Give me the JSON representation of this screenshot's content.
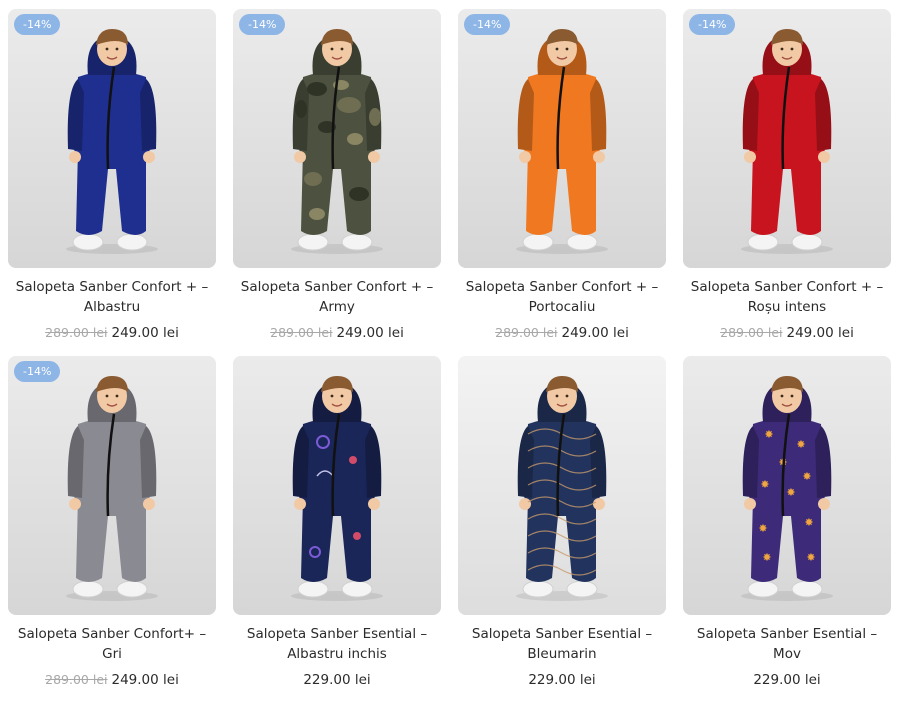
{
  "products": [
    {
      "badge": "-14%",
      "title": "Salopeta Sanber Confort + – Albastru",
      "old_price": "289.00 lei",
      "price": "249.00 lei",
      "suit_color": "#1f2f8f",
      "bg_color": "#e6e6e6",
      "pattern": "solid"
    },
    {
      "badge": "-14%",
      "title": "Salopeta Sanber Confort + – Army",
      "old_price": "289.00 lei",
      "price": "249.00 lei",
      "suit_color": "#4d5240",
      "bg_color": "#e6e6e6",
      "pattern": "camo"
    },
    {
      "badge": "-14%",
      "title": "Salopeta Sanber Confort + – Portocaliu",
      "old_price": "289.00 lei",
      "price": "249.00 lei",
      "suit_color": "#f07820",
      "bg_color": "#e6e6e6",
      "pattern": "solid"
    },
    {
      "badge": "-14%",
      "title": "Salopeta Sanber Confort + – Roșu intens",
      "old_price": "289.00 lei",
      "price": "249.00 lei",
      "suit_color": "#c8141e",
      "bg_color": "#e6e6e6",
      "pattern": "solid"
    },
    {
      "badge": "-14%",
      "title": "Salopeta Sanber Confort+ – Gri",
      "old_price": "289.00 lei",
      "price": "249.00 lei",
      "suit_color": "#8a8a92",
      "bg_color": "#e6e6e6",
      "pattern": "solid"
    },
    {
      "badge": "",
      "title": "Salopeta Sanber Esential – Albastru inchis",
      "old_price": "",
      "price": "229.00 lei",
      "suit_color": "#1a2558",
      "bg_color": "#e6e6e6",
      "pattern": "space"
    },
    {
      "badge": "",
      "title": "Salopeta Sanber Esential – Bleumarin",
      "old_price": "",
      "price": "229.00 lei",
      "suit_color": "#22345e",
      "bg_color": "#eeeeee",
      "pattern": "waves"
    },
    {
      "badge": "",
      "title": "Salopeta Sanber Esential – Mov",
      "old_price": "",
      "price": "229.00 lei",
      "suit_color": "#3d2a78",
      "bg_color": "#e6e6e6",
      "pattern": "stars"
    }
  ]
}
